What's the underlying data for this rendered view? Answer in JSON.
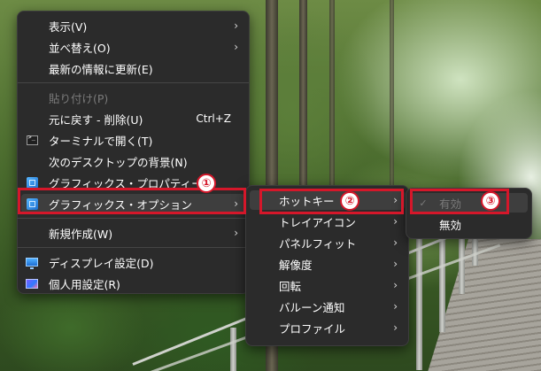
{
  "menu_main": {
    "items": [
      {
        "label": "表示(V)",
        "submenu": true
      },
      {
        "label": "並べ替え(O)",
        "submenu": true
      },
      {
        "label": "最新の情報に更新(E)"
      },
      {
        "separator": true
      },
      {
        "label": "貼り付け(P)",
        "disabled": true
      },
      {
        "label": "元に戻す - 削除(U)",
        "shortcut": "Ctrl+Z"
      },
      {
        "label": "ターミナルで開く(T)",
        "icon": "terminal-icon"
      },
      {
        "label": "次のデスクトップの背景(N)"
      },
      {
        "label": "グラフィックス・プロパティー...",
        "icon": "graphics-icon"
      },
      {
        "label": "グラフィックス・オプション",
        "icon": "graphics-icon",
        "submenu": true,
        "selected": true
      },
      {
        "separator": true
      },
      {
        "label": "新規作成(W)",
        "submenu": true
      },
      {
        "separator": true
      },
      {
        "label": "ディスプレイ設定(D)",
        "icon": "display-icon"
      },
      {
        "label": "個人用設定(R)",
        "icon": "personalize-icon"
      }
    ]
  },
  "menu_graphics": {
    "items": [
      {
        "label": "ホットキー",
        "submenu": true,
        "selected": true
      },
      {
        "label": "トレイアイコン",
        "submenu": true
      },
      {
        "label": "パネルフィット",
        "submenu": true
      },
      {
        "label": "解像度",
        "submenu": true
      },
      {
        "label": "回転",
        "submenu": true
      },
      {
        "label": "バルーン通知",
        "submenu": true
      },
      {
        "label": "プロファイル",
        "submenu": true
      }
    ]
  },
  "menu_hotkey": {
    "items": [
      {
        "label": "有効",
        "checked": true,
        "disabled": true,
        "selected": true
      },
      {
        "label": "無効"
      }
    ]
  },
  "glyphs": {
    "arrow": "›",
    "check": "✓"
  },
  "callouts": [
    "①",
    "②",
    "③"
  ],
  "colors": {
    "callout": "#d5172a",
    "menu_bg": "#2b2b2b"
  }
}
